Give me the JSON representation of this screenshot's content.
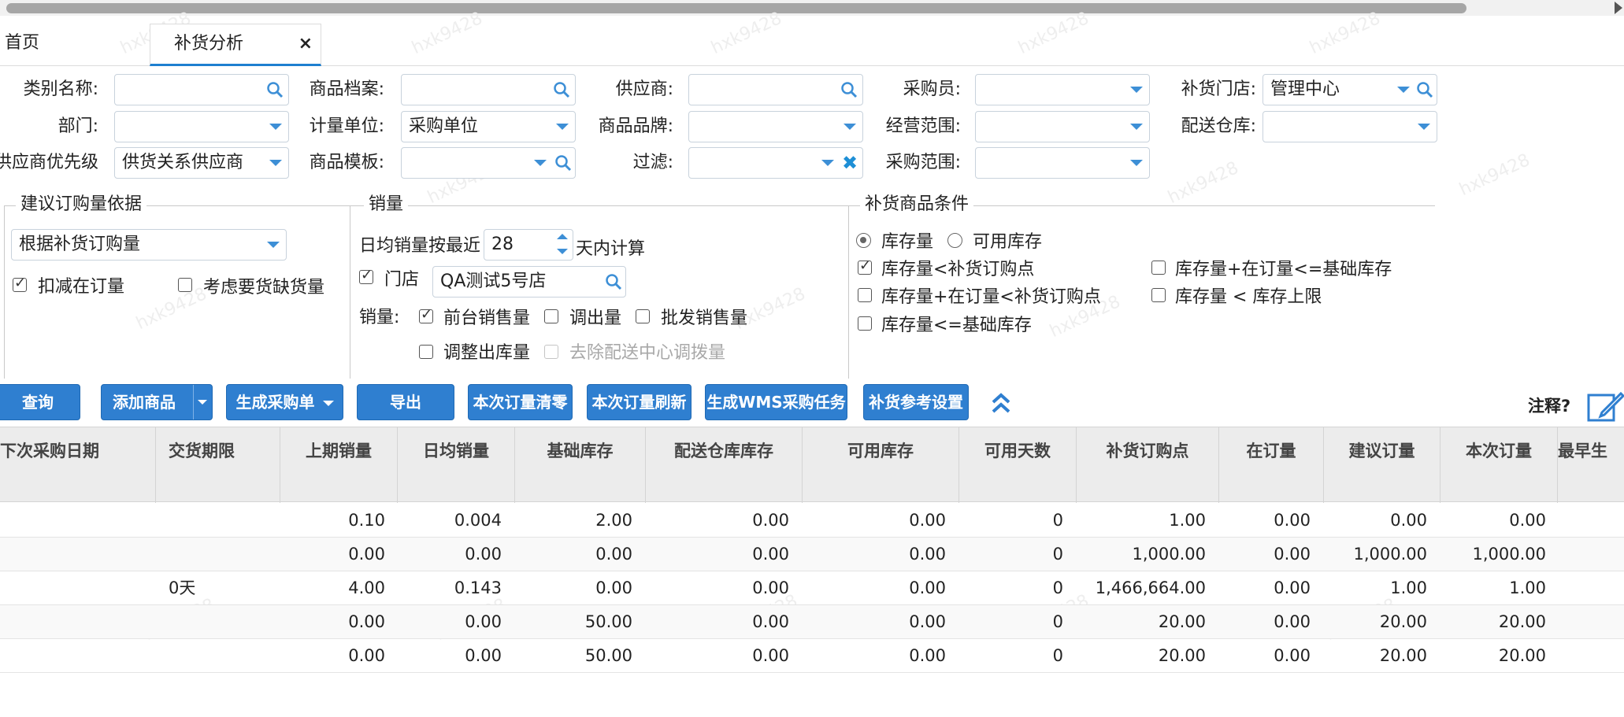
{
  "tabs": {
    "home": "首页",
    "current": "补货分析",
    "close": "×"
  },
  "filters": {
    "category": {
      "label": "类别名称:",
      "value": ""
    },
    "product": {
      "label": "商品档案:",
      "value": ""
    },
    "supplier": {
      "label": "供应商:",
      "value": ""
    },
    "buyer": {
      "label": "采购员:",
      "value": ""
    },
    "store": {
      "label": "补货门店:",
      "value": "管理中心"
    },
    "department": {
      "label": "部门:",
      "value": ""
    },
    "unit": {
      "label": "计量单位:",
      "value": "采购单位"
    },
    "brand": {
      "label": "商品品牌:",
      "value": ""
    },
    "business_scope": {
      "label": "经营范围:",
      "value": ""
    },
    "warehouse": {
      "label": "配送仓库:",
      "value": ""
    },
    "supplier_priority": {
      "label": "供应商优先级:",
      "value": "供货关系供应商"
    },
    "template": {
      "label": "商品模板:",
      "value": ""
    },
    "filter": {
      "label": "过滤:",
      "value": ""
    },
    "purchase_scope": {
      "label": "采购范围:",
      "value": ""
    }
  },
  "basis": {
    "title": "建议订购量依据",
    "select": "根据补货订购量",
    "deduct_on_order": {
      "label": "扣减在订量",
      "checked": true
    },
    "consider_shortage": {
      "label": "考虑要货缺货量",
      "checked": false
    }
  },
  "sales": {
    "title": "销量",
    "days_prefix": "日均销量按最近",
    "days": "28",
    "days_suffix": "天内计算",
    "store": {
      "label": "门店",
      "checked": true,
      "value": "QA测试5号店"
    },
    "sales_label": "销量:",
    "front_sales": {
      "label": "前台销售量",
      "checked": true
    },
    "transfer_out": {
      "label": "调出量",
      "checked": false
    },
    "wholesale": {
      "label": "批发销售量",
      "checked": false
    },
    "adjust_out": {
      "label": "调整出库量",
      "checked": false
    },
    "exclude_dc": {
      "label": "去除配送中心调拨量",
      "checked": false,
      "disabled": true
    }
  },
  "conditions": {
    "title": "补货商品条件",
    "stock": {
      "label": "库存量",
      "selected": true
    },
    "available": {
      "label": "可用库存",
      "selected": false
    },
    "c1": {
      "label": "库存量<补货订购点",
      "checked": true
    },
    "c2": {
      "label": "库存量+在订量<=基础库存",
      "checked": false
    },
    "c3": {
      "label": "库存量+在订量<补货订购点",
      "checked": false
    },
    "c4": {
      "label": "库存量 < 库存上限",
      "checked": false
    },
    "c5": {
      "label": "库存量<=基础库存",
      "checked": false
    }
  },
  "toolbar": {
    "query": "查询",
    "add_product": "添加商品",
    "generate_po": "生成采购单",
    "export": "导出",
    "clear_qty": "本次订量清零",
    "refresh_qty": "本次订量刷新",
    "wms_task": "生成WMS采购任务",
    "ref_settings": "补货参考设置",
    "note": "注释?"
  },
  "table": {
    "columns": [
      "下次采购日期",
      "交货期限",
      "上期销量",
      "日均销量",
      "基础库存",
      "配送仓库库存",
      "可用库存",
      "可用天数",
      "补货订购点",
      "在订量",
      "建议订量",
      "本次订量",
      "最早生"
    ],
    "rows": [
      [
        "",
        "",
        "0.10",
        "0.004",
        "2.00",
        "0.00",
        "0.00",
        "0",
        "1.00",
        "0.00",
        "0.00",
        "0.00"
      ],
      [
        "",
        "",
        "0.00",
        "0.00",
        "0.00",
        "0.00",
        "0.00",
        "0",
        "1,000.00",
        "0.00",
        "1,000.00",
        "1,000.00"
      ],
      [
        "",
        "0天",
        "4.00",
        "0.143",
        "0.00",
        "0.00",
        "0.00",
        "0",
        "1,466,664.00",
        "0.00",
        "1.00",
        "1.00"
      ],
      [
        "",
        "",
        "0.00",
        "0.00",
        "50.00",
        "0.00",
        "0.00",
        "0",
        "20.00",
        "0.00",
        "20.00",
        "20.00"
      ],
      [
        "",
        "",
        "0.00",
        "0.00",
        "50.00",
        "0.00",
        "0.00",
        "0",
        "20.00",
        "0.00",
        "20.00",
        "20.00"
      ]
    ]
  },
  "watermark": "hxk9428",
  "colors": {
    "accent": "#2f7fd0",
    "icon": "#3d8fd6"
  }
}
